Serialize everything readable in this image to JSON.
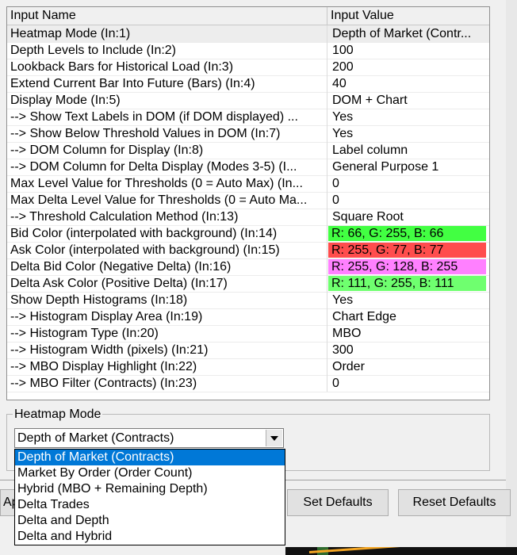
{
  "grid": {
    "header": {
      "name": "Input Name",
      "value": "Input Value"
    },
    "rows": [
      {
        "name": "Heatmap Mode   (In:1)",
        "value": "Depth of Market (Contr..."
      },
      {
        "name": "Depth Levels to Include   (In:2)",
        "value": "100"
      },
      {
        "name": "Lookback Bars for Historical Load   (In:3)",
        "value": "200"
      },
      {
        "name": "Extend Current Bar Into Future (Bars)   (In:4)",
        "value": "40"
      },
      {
        "name": "Display Mode   (In:5)",
        "value": "DOM + Chart"
      },
      {
        "name": "--> Show Text Labels in DOM (if DOM displayed)   ...",
        "value": "Yes"
      },
      {
        "name": "--> Show Below Threshold Values in DOM   (In:7)",
        "value": "Yes"
      },
      {
        "name": "--> DOM Column for Display   (In:8)",
        "value": "Label column"
      },
      {
        "name": "--> DOM Column for Delta Display (Modes 3-5)   (I...",
        "value": " General Purpose 1"
      },
      {
        "name": "Max Level Value for Thresholds (0 = Auto Max)   (In...",
        "value": "0"
      },
      {
        "name": "Max Delta Level Value for Thresholds (0 = Auto Ma...",
        "value": "0"
      },
      {
        "name": "--> Threshold Calculation Method   (In:13)",
        "value": "Square Root"
      },
      {
        "name": "Bid Color (interpolated with background)   (In:14)",
        "value": "R: 66, G: 255, B: 66",
        "color": "#42ff42"
      },
      {
        "name": "Ask Color (interpolated with background)   (In:15)",
        "value": "R: 255, G: 77, B: 77",
        "color": "#ff4d4d"
      },
      {
        "name": "Delta Bid Color (Negative Delta)   (In:16)",
        "value": "R: 255, G: 128, B: 255",
        "color": "#ff80ff"
      },
      {
        "name": "Delta Ask Color (Positive Delta)   (In:17)",
        "value": "R: 111, G: 255, B: 111",
        "color": "#6fff6f"
      },
      {
        "name": "Show Depth Histograms   (In:18)",
        "value": "Yes"
      },
      {
        "name": "--> Histogram Display Area   (In:19)",
        "value": "Chart Edge"
      },
      {
        "name": "--> Histogram Type   (In:20)",
        "value": "MBO"
      },
      {
        "name": "--> Histogram Width (pixels)   (In:21)",
        "value": "300"
      },
      {
        "name": "--> MBO Display Highlight   (In:22)",
        "value": "Order"
      },
      {
        "name": "--> MBO Filter (Contracts)   (In:23)",
        "value": "0"
      }
    ]
  },
  "editor": {
    "group_label": "Heatmap Mode",
    "selected": "Depth of Market (Contracts)",
    "options": [
      "Depth of Market (Contracts)",
      "Market By Order (Order Count)",
      "Hybrid (MBO + Remaining Depth)",
      "Delta Trades",
      "Delta and Depth",
      "Delta and Hybrid"
    ]
  },
  "buttons": {
    "apply_label": "Ap",
    "set_defaults_label": "Set Defaults",
    "reset_defaults_label": "Reset Defaults"
  }
}
